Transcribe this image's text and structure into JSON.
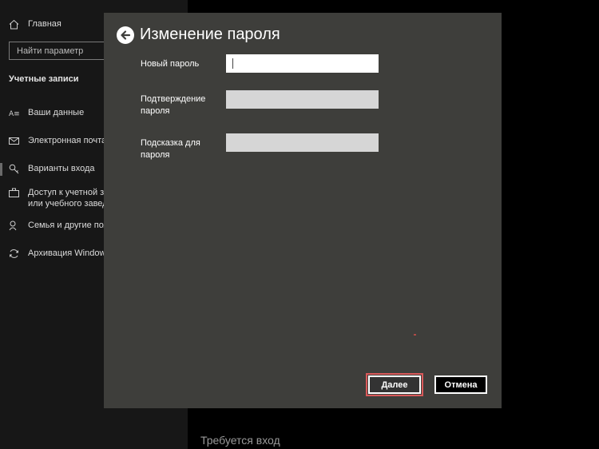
{
  "sidebar": {
    "home_label": "Главная",
    "search_placeholder": "Найти параметр",
    "section_title": "Учетные записи",
    "items": [
      {
        "label": "Ваши данные",
        "icon": "person-card-icon"
      },
      {
        "label": "Электронная почта и учетные записи",
        "icon": "mail-icon"
      },
      {
        "label": "Варианты входа",
        "icon": "key-icon"
      },
      {
        "label": "Доступ к учетной записи места работы\nили учебного заведения",
        "icon": "briefcase-icon"
      },
      {
        "label": "Семья и другие пользователи",
        "icon": "person-add-icon"
      },
      {
        "label": "Архивация Windows",
        "icon": "sync-icon"
      }
    ]
  },
  "content": {
    "bottom_heading": "Требуется вход"
  },
  "dialog": {
    "title": "Изменение пароля",
    "fields": [
      {
        "label": "Новый пароль",
        "value": ""
      },
      {
        "label": "Подтверждение\nпароля",
        "value": ""
      },
      {
        "label": "Подсказка для\nпароля",
        "value": ""
      }
    ],
    "next_label": "Далее",
    "cancel_label": "Отмена"
  },
  "colors": {
    "dialog_bg": "#3e3e3b",
    "sidebar_bg": "#171717",
    "highlight": "#d9595a"
  }
}
